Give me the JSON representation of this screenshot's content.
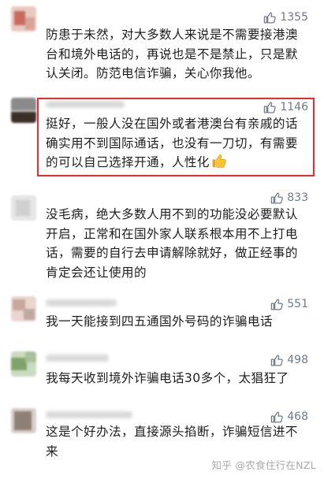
{
  "comments": [
    {
      "likes": "1355",
      "text": "防患于未然，对大多数人来说是不需要接港澳台和境外电话的，再说也是不是禁止，只是默认关闭。防范电信诈骗，关心你我他。"
    },
    {
      "likes": "1146",
      "text": "挺好，一般人没在国外或者港澳台有亲戚的话确实用不到国际通话，也没有一刀切，有需要的可以自己选择开通，人性化",
      "highlighted": true,
      "trailing_emoji": "thumbs-up"
    },
    {
      "likes": "833",
      "text": "没毛病，绝大多数人用不到的功能没必要默认开启，正常和在国外家人联系根本用不上打电话，需要的自行去申请解除就好，做正经事的肯定会还让使用的"
    },
    {
      "likes": "551",
      "text": "我一天能接到四五通国外号码的诈骗电话"
    },
    {
      "likes": "498",
      "text": "我每天收到境外诈骗电话30多个，太猖狂了"
    },
    {
      "likes": "468",
      "text": "这是个好办法，直接源头掐断，诈骗短信进不来"
    }
  ],
  "watermark": "知乎 @农食住行在NZL",
  "colors": {
    "highlight_border": "#ef2a2a",
    "like_text": "#6f7a8a"
  }
}
